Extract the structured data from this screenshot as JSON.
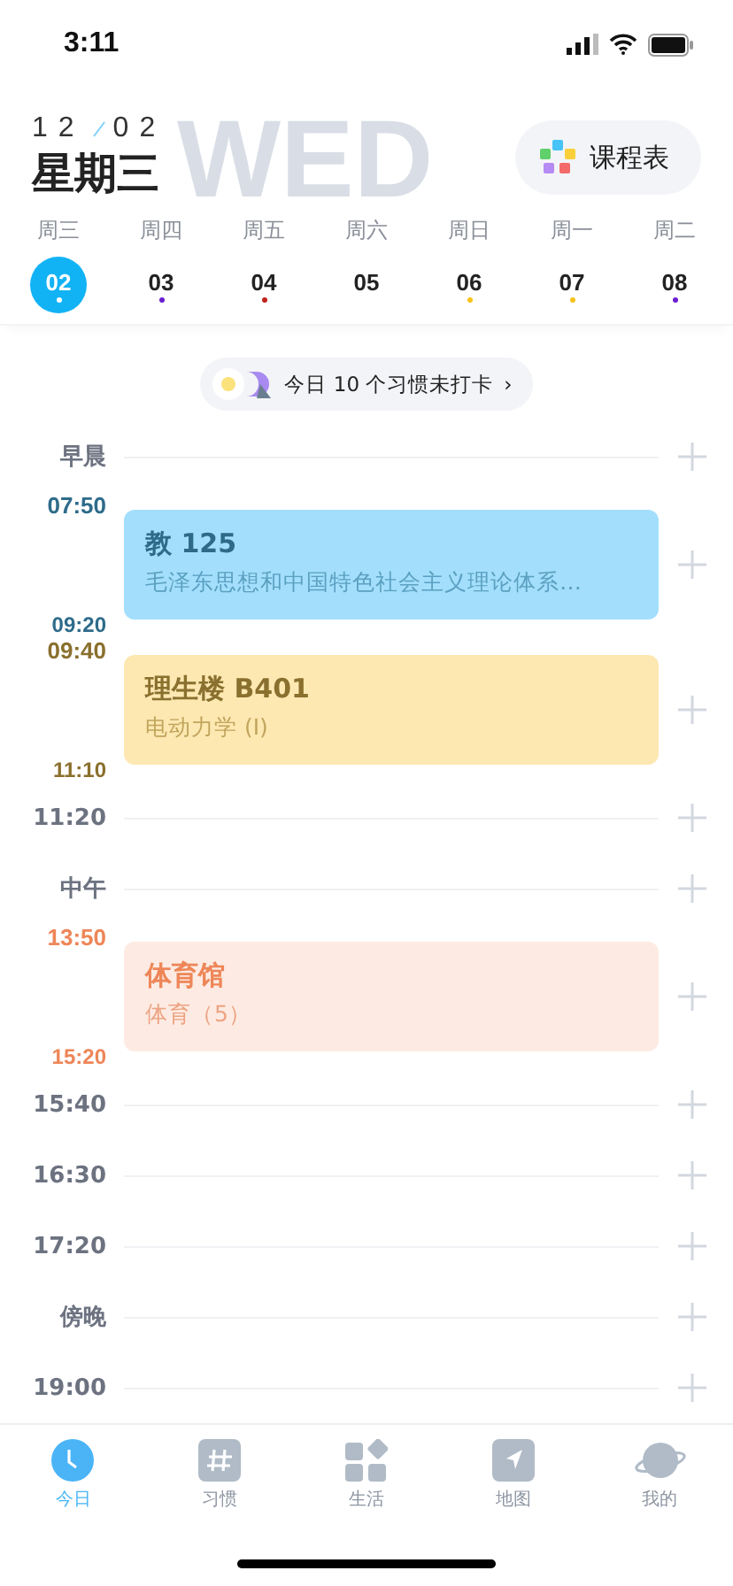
{
  "status_bar": {
    "time": "3:11"
  },
  "header": {
    "month": "12",
    "day": "02",
    "weekday": "星期三",
    "watermark": "WED",
    "schedule_button": "课程表"
  },
  "week": [
    {
      "label": "周三",
      "date": "02",
      "selected": true,
      "color": "#ffffff"
    },
    {
      "label": "周四",
      "date": "03",
      "selected": false,
      "color": "#6a1fd0"
    },
    {
      "label": "周五",
      "date": "04",
      "selected": false,
      "color": "#c0241c"
    },
    {
      "label": "周六",
      "date": "05",
      "selected": false
    },
    {
      "label": "周日",
      "date": "06",
      "selected": false,
      "color": "#f8c21a"
    },
    {
      "label": "周一",
      "date": "07",
      "selected": false,
      "color": "#f8c21a"
    },
    {
      "label": "周二",
      "date": "08",
      "selected": false,
      "color": "#6a1fd0"
    }
  ],
  "habit_banner": {
    "text": "今日 10 个习惯未打卡",
    "chevron": "›"
  },
  "timeline": [
    {
      "kind": "label",
      "label": "早晨"
    },
    {
      "kind": "course",
      "start": "07:50",
      "end": "09:20",
      "room": "教 125",
      "name": "毛泽东思想和中国特色社会主义理论体系…",
      "color": "#a3dffd"
    },
    {
      "kind": "course",
      "start": "09:40",
      "end": "11:10",
      "room": "理生楼 B401",
      "name": "电动力学 (I)",
      "color": "#fde8b2"
    },
    {
      "kind": "label",
      "label": "11:20"
    },
    {
      "kind": "label",
      "label": "中午"
    },
    {
      "kind": "course",
      "start": "13:50",
      "end": "15:20",
      "room": "体育馆",
      "name": "体育（5）",
      "color": "#fdebe3"
    },
    {
      "kind": "label",
      "label": "15:40"
    },
    {
      "kind": "label",
      "label": "16:30"
    },
    {
      "kind": "label",
      "label": "17:20"
    },
    {
      "kind": "label",
      "label": "傍晚"
    },
    {
      "kind": "label",
      "label": "19:00"
    }
  ],
  "tab_bar": [
    {
      "label": "今日",
      "kind": "clock",
      "selected": true
    },
    {
      "label": "习惯",
      "kind": "hash",
      "selected": false
    },
    {
      "label": "生活",
      "kind": "grid",
      "selected": false
    },
    {
      "label": "地图",
      "kind": "map",
      "selected": false
    },
    {
      "label": "我的",
      "kind": "planet",
      "selected": false
    }
  ]
}
